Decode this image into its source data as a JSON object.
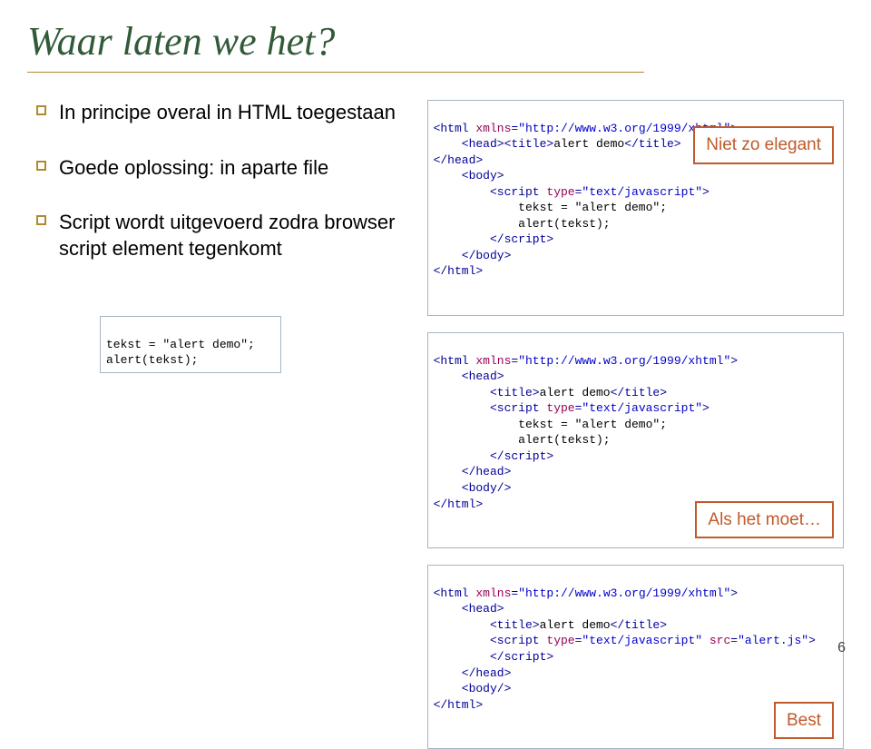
{
  "title": "Waar laten we het?",
  "bullets": [
    "In principe overal in HTML toegestaan",
    "Goede oplossing: in aparte file",
    "Script wordt uitgevoerd zodra browser script element tegenkomt"
  ],
  "labels": {
    "label1": "Niet zo elegant",
    "label2": "Als het moet…",
    "label3": "Best"
  },
  "code1": {
    "l1a": "<html",
    "l1b": " xmlns",
    "l1c": "=",
    "l1d": "\"http://www.w3.org/1999/xhtml\"",
    "l1e": ">",
    "l2a": "    <head><title>",
    "l2b": "alert demo",
    "l2c": "</title>",
    "l3": "</head>",
    "l4": "    <body>",
    "l5a": "        <script",
    "l5b": " type",
    "l5c": "=",
    "l5d": "\"text/javascript\"",
    "l5e": ">",
    "l6": "            tekst = \"alert demo\";",
    "l7": "            alert(tekst);",
    "l8": "        </scr",
    "l8b": "ipt>",
    "l9": "    </body>",
    "l10": "</html>"
  },
  "code2": {
    "l1a": "<html",
    "l1b": " xmlns",
    "l1c": "=",
    "l1d": "\"http://www.w3.org/1999/xhtml\"",
    "l1e": ">",
    "l2": "    <head>",
    "l3a": "        <title>",
    "l3b": "alert demo",
    "l3c": "</title>",
    "l4a": "        <script",
    "l4b": " type",
    "l4c": "=",
    "l4d": "\"text/javascript\"",
    "l4e": ">",
    "l5": "            tekst = \"alert demo\";",
    "l6": "            alert(tekst);",
    "l7": "        </scr",
    "l7b": "ipt>",
    "l8": "    </head>",
    "l9": "    <body/>",
    "l10": "</html>"
  },
  "code3": {
    "l1a": "<html",
    "l1b": " xmlns",
    "l1c": "=",
    "l1d": "\"http://www.w3.org/1999/xhtml\"",
    "l1e": ">",
    "l2": "    <head>",
    "l3a": "        <title>",
    "l3b": "alert demo",
    "l3c": "</title>",
    "l4a": "        <script",
    "l4b": " type",
    "l4c": "=",
    "l4d": "\"text/javascript\"",
    "l4e": " src",
    "l4f": "=",
    "l4g": "\"alert.js\"",
    "l4h": ">",
    "l5": "        </scr",
    "l5b": "ipt>",
    "l6": "    </head>",
    "l7": "    <body/>",
    "l8": "</html>"
  },
  "codeSmall": {
    "l1": "tekst = \"alert demo\";",
    "l2": "alert(tekst);"
  },
  "pageNumber": "6"
}
